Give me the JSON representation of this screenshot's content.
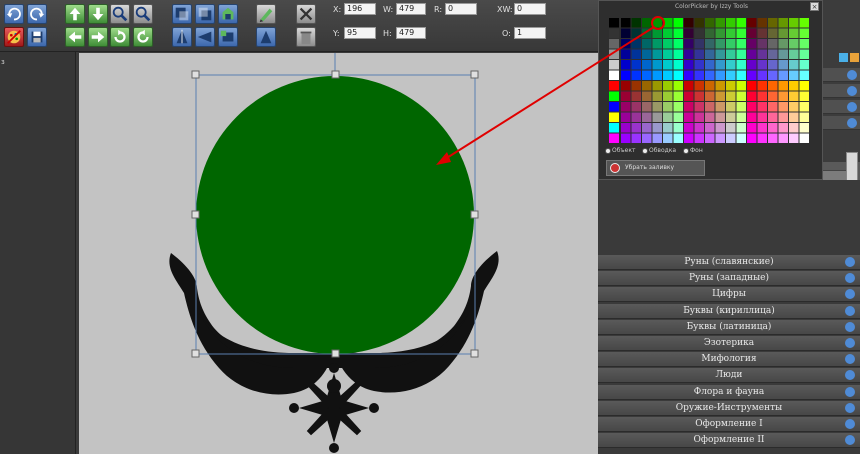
{
  "transform": {
    "x_label": "X:",
    "x_value": "196",
    "y_label": "Y:",
    "y_value": "95",
    "w_label": "W:",
    "w_value": "479",
    "h_label": "H:",
    "h_value": "479",
    "r_label": "R:",
    "r_value": "0",
    "xw_label": "XW:",
    "xw_value": "0",
    "o_label": "O:",
    "o_value": "1"
  },
  "left_panel": {
    "text": "з"
  },
  "color_picker": {
    "title": "ColorPicker by Izzy Tools",
    "close": "×",
    "options": [
      "Объект",
      "Обводка",
      "Фон"
    ],
    "remove_fill": "Убрать заливку"
  },
  "categories": [
    "Руны (славянские)",
    "Руны (западные)",
    "Цифры",
    "Буквы (кириллица)",
    "Буквы (латиница)",
    "Эзотерика",
    "Мифология",
    "Люди",
    "Флора и фауна",
    "Оружие-Инструменты",
    "Оформление I",
    "Оформление II"
  ],
  "colors": {
    "selected_fill": "#006600",
    "selection_stroke": "#5a7fb0",
    "arrow": "#e00000"
  },
  "icons": {
    "shapes_row1": [
      "rect-shape",
      "bar-shape",
      "semicircle-shape",
      "arch-shape",
      "half-hexagon-shape"
    ],
    "shapes_row2": [
      "triangle-shape",
      "right-triangle-shape",
      "diamond-shape",
      "pentagon-shape",
      "hexagon-shape"
    ]
  }
}
